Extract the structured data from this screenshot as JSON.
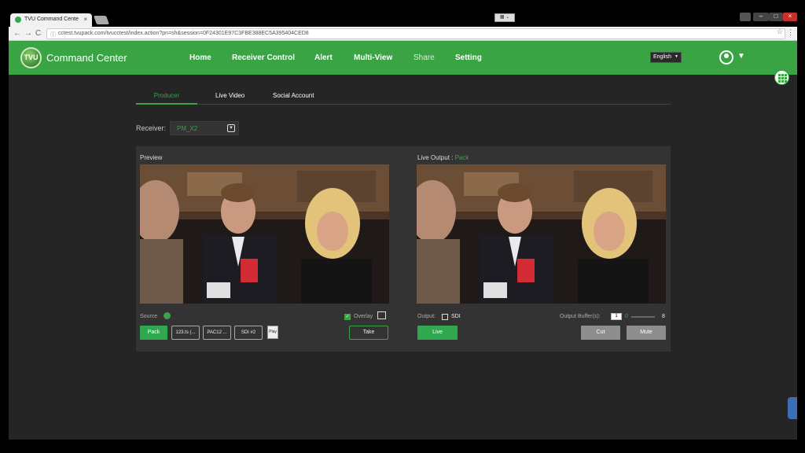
{
  "browser": {
    "tab_title": "TVU Command Cente",
    "tab_close": "×",
    "url": "cctest.tvupack.com/tvucctest/index.action?pn=sh&session=0F24301E97C3FBE388EC5A395404CED8",
    "back": "←",
    "forward": "→",
    "reload": "C",
    "star": "☆",
    "menu": "⋮",
    "controls": {
      "minimize": "–",
      "maximize": "□",
      "close": "×"
    }
  },
  "header": {
    "logo": "TVU",
    "title": "Command Center",
    "nav": [
      "Home",
      "Receiver Control",
      "Alert",
      "Multi-View",
      "Share",
      "Setting"
    ],
    "active_nav": "Share",
    "language": "English",
    "user_caret": "▼"
  },
  "subnav": {
    "tabs": [
      "Producer",
      "Live Video",
      "Social Account"
    ],
    "active": "Producer"
  },
  "receiver": {
    "label": "Receiver:",
    "value": "PM_X2"
  },
  "preview": {
    "title": "Preview",
    "source_label": "Source",
    "overlay_label": "Overlay",
    "overlay_checked": true,
    "sources": [
      "Pack",
      "123.ts (...",
      "PAC12 ...",
      "SDI #2"
    ],
    "take_label": "Take"
  },
  "live_output": {
    "title": "Live Output :",
    "source": "Pack",
    "output_label": "Output:",
    "sdi_label": "SDI",
    "sdi_checked": false,
    "buffer_label": "Output Buffer(s):",
    "buffer_value": "1",
    "buffer_min": "0",
    "buffer_max": "8",
    "live_label": "Live",
    "cut_label": "Cut",
    "mute_label": "Mute"
  },
  "colors": {
    "accent": "#3aa445",
    "background": "#252525",
    "panel": "#333333"
  }
}
